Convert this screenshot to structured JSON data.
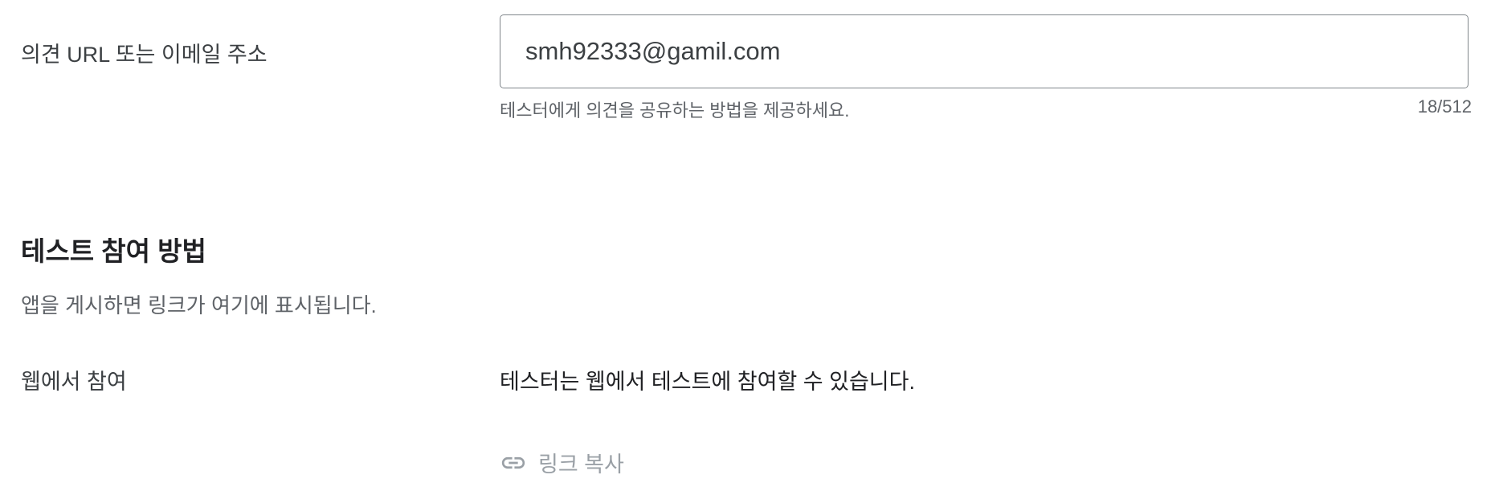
{
  "feedback": {
    "label": "의견 URL 또는 이메일 주소",
    "value": "smh92333@gamil.com",
    "helper": "테스터에게 의견을 공유하는 방법을 제공하세요.",
    "counter": "18/512"
  },
  "join": {
    "title": "테스트 참여 방법",
    "description": "앱을 게시하면 링크가 여기에 표시됩니다.",
    "web_label": "웹에서 참여",
    "web_description": "테스터는 웹에서 테스트에 참여할 수 있습니다.",
    "copy_link_label": "링크 복사",
    "copy_link_icon": "link-icon",
    "copy_link_color": "#9aa0a6"
  }
}
